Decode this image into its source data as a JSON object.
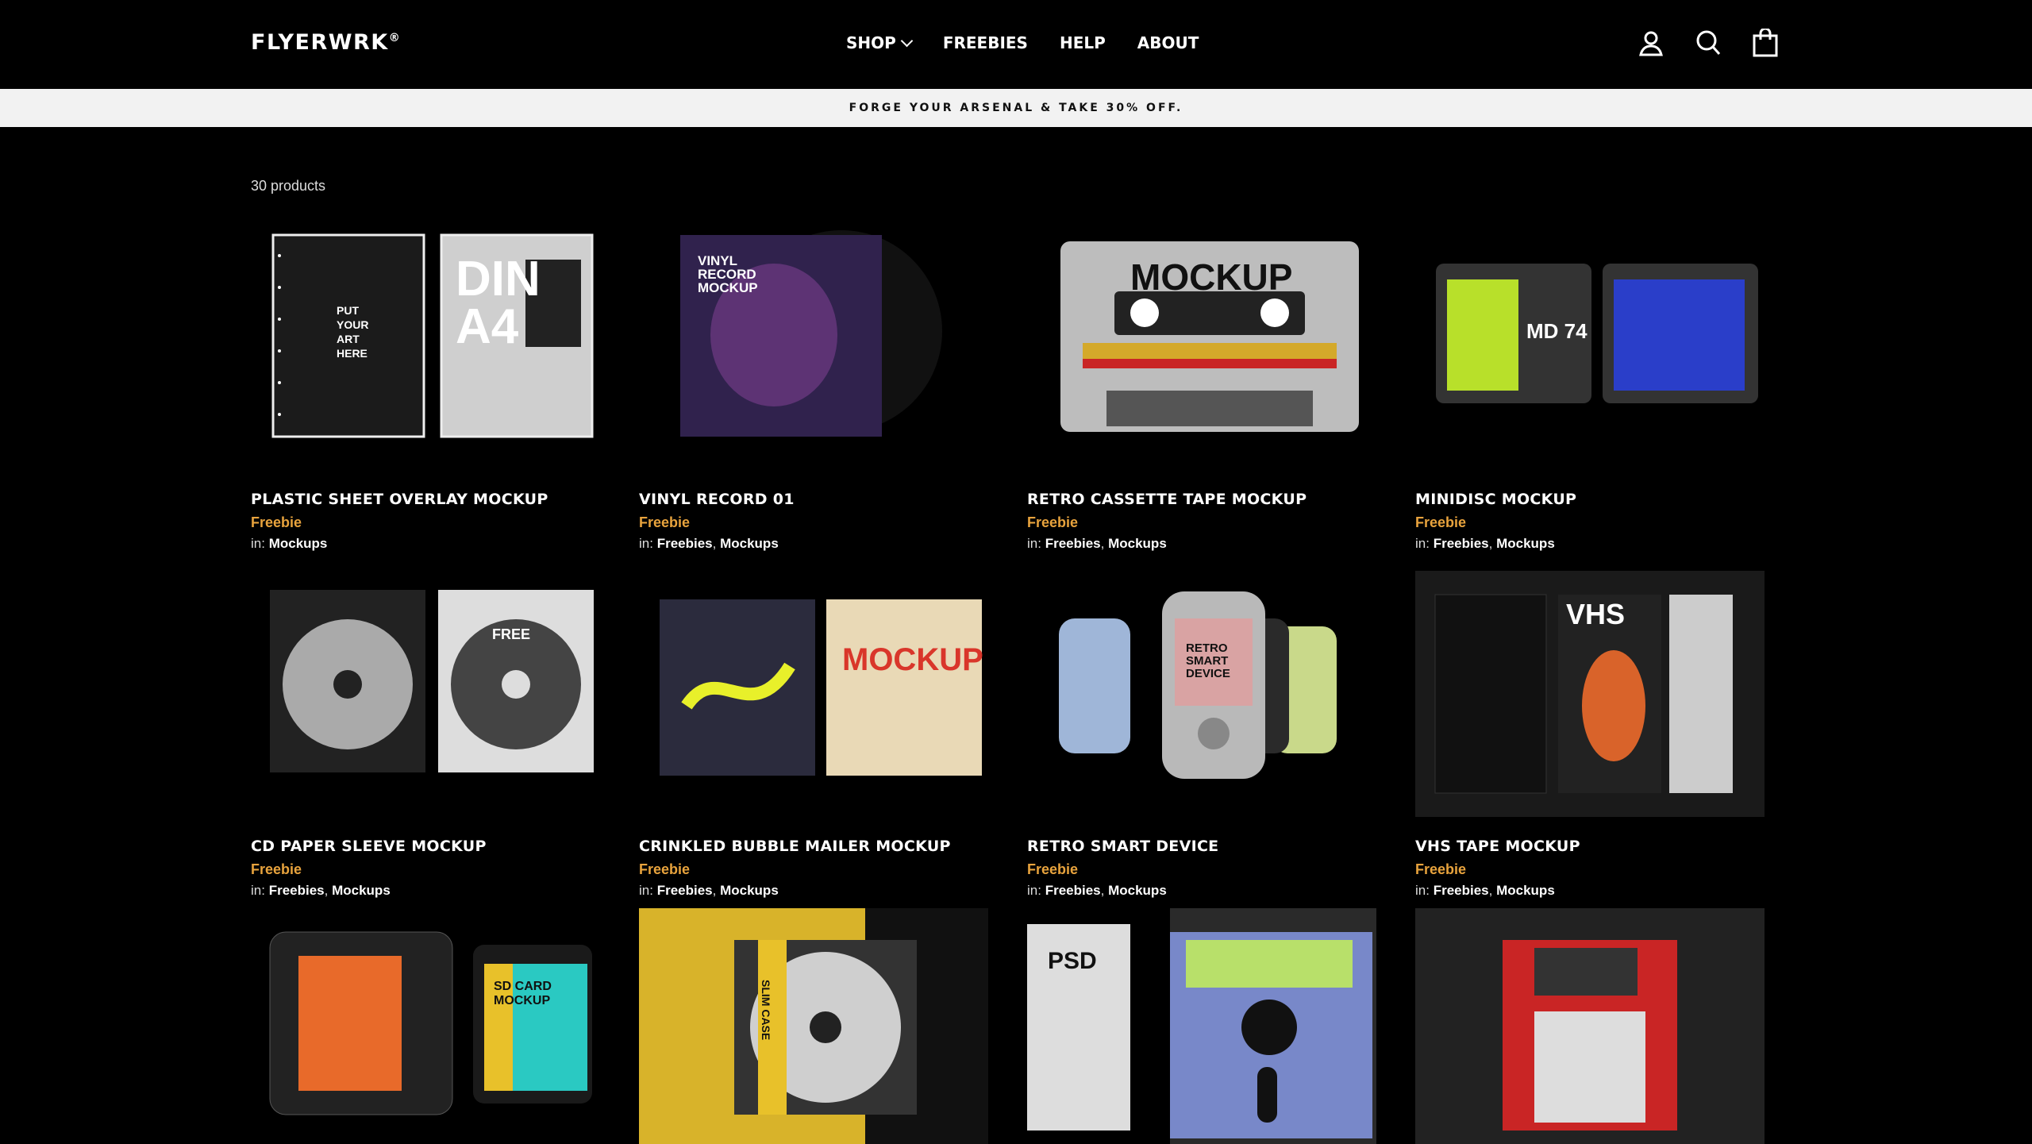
{
  "header": {
    "logo": "FLYERWRK",
    "logo_mark": "®",
    "nav": [
      "SHOP",
      "FREEBIES",
      "HELP",
      "ABOUT"
    ],
    "icons": [
      "user-icon",
      "search-icon",
      "bag-icon"
    ]
  },
  "promo": {
    "text": "FORGE YOUR ARSENAL & TAKE 30% OFF."
  },
  "collection": {
    "count": "30 products"
  },
  "products": [
    {
      "title": "PLASTIC SHEET OVERLAY MOCKUP",
      "price": "Freebie",
      "in_label": "in:",
      "categories": [
        "Mockups"
      ]
    },
    {
      "title": "VINYL RECORD 01",
      "price": "Freebie",
      "in_label": "in:",
      "categories": [
        "Freebies",
        "Mockups"
      ]
    },
    {
      "title": "RETRO CASSETTE TAPE MOCKUP",
      "price": "Freebie",
      "in_label": "in:",
      "categories": [
        "Freebies",
        "Mockups"
      ]
    },
    {
      "title": "MINIDISC MOCKUP",
      "price": "Freebie",
      "in_label": "in:",
      "categories": [
        "Freebies",
        "Mockups"
      ]
    },
    {
      "title": "CD PAPER SLEEVE MOCKUP",
      "price": "Freebie",
      "in_label": "in:",
      "categories": [
        "Freebies",
        "Mockups"
      ]
    },
    {
      "title": "CRINKLED BUBBLE MAILER MOCKUP",
      "price": "Freebie",
      "in_label": "in:",
      "categories": [
        "Freebies",
        "Mockups"
      ]
    },
    {
      "title": "RETRO SMART DEVICE",
      "price": "Freebie",
      "in_label": "in:",
      "categories": [
        "Freebies",
        "Mockups"
      ]
    },
    {
      "title": "VHS TAPE MOCKUP",
      "price": "Freebie",
      "in_label": "in:",
      "categories": [
        "Freebies",
        "Mockups"
      ]
    }
  ],
  "artwork_text": {
    "plastic_sheet": [
      "PUT",
      "YOUR",
      "ART",
      "HERE",
      "DIN",
      "A4"
    ],
    "vinyl": [
      "VINYL",
      "RECORD",
      "MOCKUP"
    ],
    "cassette": "MOCKUP",
    "minidisc": "MD 74",
    "vhs": "VHS",
    "cd": "FREE",
    "mailer": "MOCKUP",
    "device": [
      "RETRO",
      "SMART",
      "DEVICE"
    ],
    "sdcard": [
      "SD CARD",
      "MOCKUP"
    ],
    "slimcase": "SLIM CASE",
    "floppy": "PSD"
  },
  "colors": {
    "accent": "#e8a33d",
    "promo_bg": "#f2f2f2",
    "background": "#000000"
  }
}
